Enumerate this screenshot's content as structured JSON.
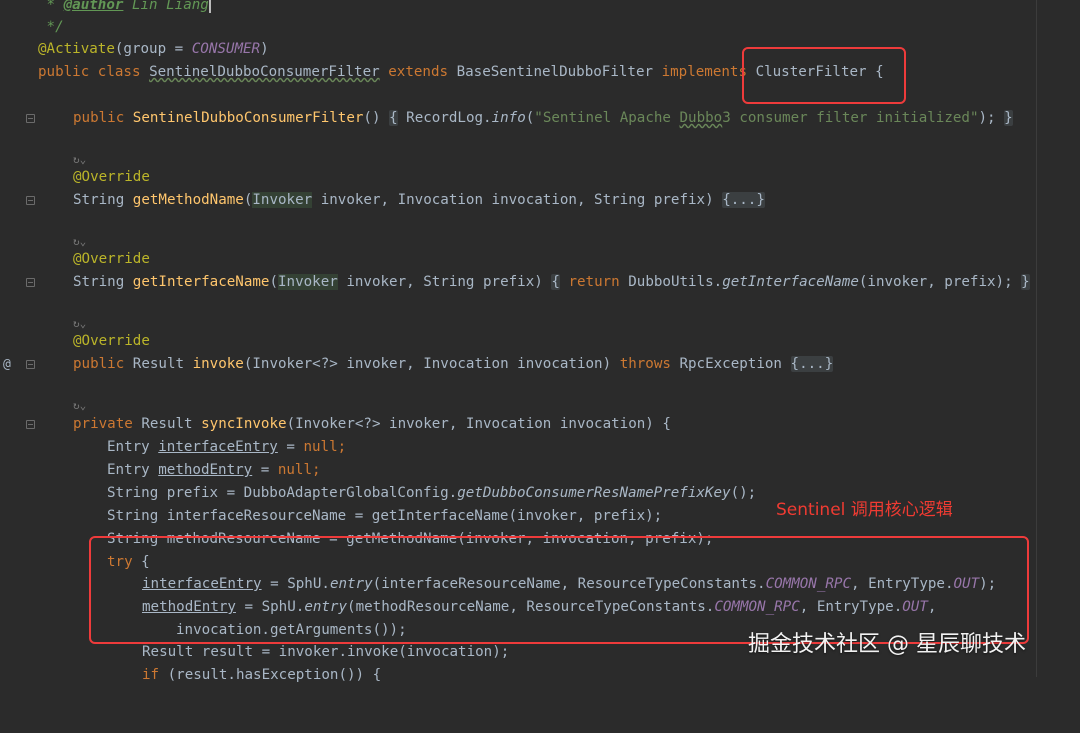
{
  "doc_comment": {
    "star": " * ",
    "tag": "@author",
    "name": " Lin Liang",
    "close": " */"
  },
  "class_decl": {
    "annotation": "@Activate",
    "annotation_args_open": "(group = ",
    "annotation_const": "CONSUMER",
    "annotation_args_close": ")",
    "kw_public": "public",
    "kw_class": "class",
    "class_name": "SentinelDubboConsumerFilter",
    "kw_extends": "extends",
    "base_class": "BaseSentinelDubboFilter",
    "kw_implements": "implements",
    "interface_name": "ClusterFilter",
    "brace": "{"
  },
  "constructor": {
    "kw_public": "public",
    "name": "SentinelDubboConsumerFilter",
    "parens": "()",
    "fold_open": "{",
    "body_prefix": " RecordLog.",
    "body_method": "info",
    "paren_open": "(",
    "str_a": "\"Sentinel Apache ",
    "str_b": "Dubbo",
    "str_c": "3 consumer filter initialized\"",
    "paren_close": ");",
    "fold_close": "}"
  },
  "usage_hint": "↻⌄",
  "override": "@Override",
  "get_method_name": {
    "ret": "String",
    "name": "getMethodName",
    "paren": "(",
    "param_type": "Invoker",
    "rest": " invoker, Invocation invocation, String prefix) ",
    "fold": "{...}"
  },
  "get_interface_name": {
    "ret": "String",
    "name": "getInterfaceName",
    "paren": "(",
    "param_type": "Invoker",
    "rest": " invoker, String prefix) ",
    "fold_open": "{",
    "kw_return": "return",
    "call_prefix": " DubboUtils.",
    "call_method": "getInterfaceName",
    "call_args": "(invoker, prefix);",
    "fold_close": "}"
  },
  "invoke": {
    "kw_public": "public",
    "ret": "Result",
    "name": "invoke",
    "params": "(Invoker<?> invoker, Invocation invocation) ",
    "kw_throws": "throws",
    "exception": " RpcException ",
    "fold": "{...}"
  },
  "sync_invoke": {
    "kw_private": "private",
    "ret": "Result",
    "name": "syncInvoke",
    "params": "(Invoker<?> invoker, Invocation invocation) {"
  },
  "body": {
    "l1_type": "Entry ",
    "l1_var": "interfaceEntry",
    "l1_eq": " = ",
    "l1_null": "null",
    "l1_end": ";",
    "l2_type": "Entry ",
    "l2_var": "methodEntry",
    "l2_eq": " = ",
    "l2_null": "null",
    "l2_end": ";",
    "l3_prefix": "String prefix = DubboAdapterGlobalConfig.",
    "l3_method": "getDubboConsumerResNamePrefixKey",
    "l3_end": "();",
    "l4": "String interfaceResourceName = getInterfaceName(invoker, prefix);",
    "l5": "String methodResourceName = getMethodName(invoker, invocation, prefix);",
    "l6_try": "try",
    "l6_brace": " {",
    "l7_var": "interfaceEntry",
    "l7_a": " = SphU.",
    "l7_method": "entry",
    "l7_b": "(interfaceResourceName, ResourceTypeConstants.",
    "l7_c1": "COMMON_RPC",
    "l7_c": ", EntryType.",
    "l7_c2": "OUT",
    "l7_end": ");",
    "l8_var": "methodEntry",
    "l8_a": " = SphU.",
    "l8_method": "entry",
    "l8_b": "(methodResourceName, ResourceTypeConstants.",
    "l8_c1": "COMMON_RPC",
    "l8_c": ", EntryType.",
    "l8_c2": "OUT",
    "l8_end": ",",
    "l9": "invocation.getArguments());",
    "l10": "Result result = invoker.invoke(invocation);",
    "l11_kw": "if",
    "l11_rest": " (result.hasException()) {"
  },
  "gutter_at": "@",
  "annotation_note": "Sentinel 调用核心逻辑",
  "watermark": "掘金技术社区 @ 星辰聊技术",
  "colors": {
    "background": "#2b2b2b",
    "keyword": "#cc7832",
    "annotation": "#bbb529",
    "string": "#6a8759",
    "method": "#ffc66d",
    "constant": "#9876aa",
    "highlight_box": "#ee3b3b"
  }
}
